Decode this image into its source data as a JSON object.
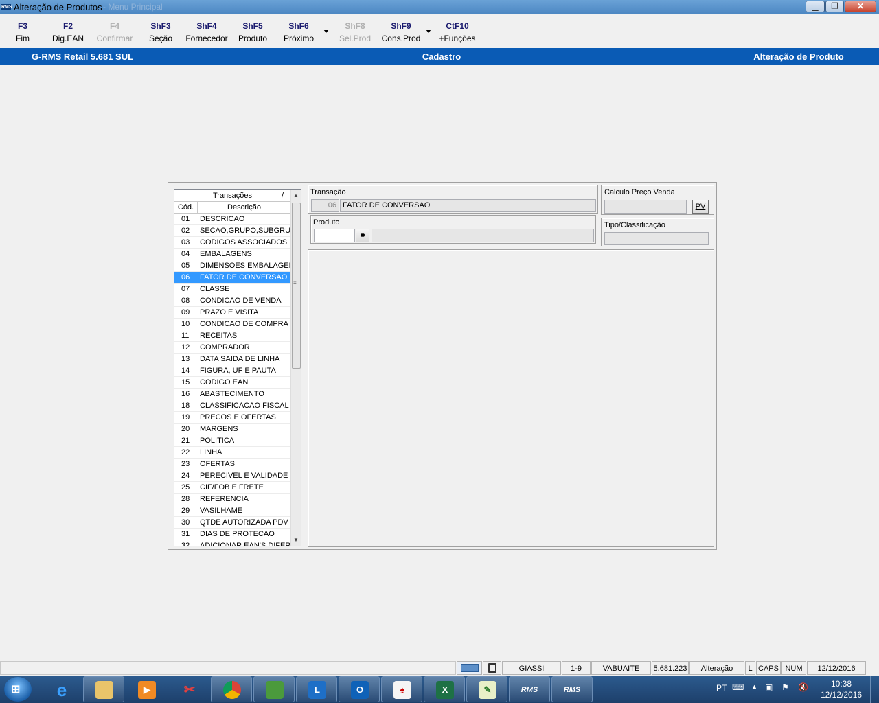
{
  "window": {
    "icon_label": "RMS",
    "title": "Alteração de Produtos",
    "title_faded": "-  Menu Principal",
    "buttons": [
      "minimize",
      "maximize",
      "close"
    ]
  },
  "toolbar": [
    {
      "key": "F3",
      "label": "Fim",
      "disabled": false
    },
    {
      "key": "F2",
      "label": "Dig.EAN",
      "disabled": false
    },
    {
      "key": "F4",
      "label": "Confirmar",
      "disabled": true
    },
    {
      "key": "ShF3",
      "label": "Seção",
      "disabled": false
    },
    {
      "key": "ShF4",
      "label": "Fornecedor",
      "disabled": false
    },
    {
      "key": "ShF5",
      "label": "Produto",
      "disabled": false
    },
    {
      "key": "ShF6",
      "label": "Próximo",
      "disabled": false
    },
    {
      "key": "ShF8",
      "label": "Sel.Prod",
      "disabled": true
    },
    {
      "key": "ShF9",
      "label": "Cons.Prod",
      "disabled": false
    },
    {
      "key": "CtF10",
      "label": "+Funções",
      "disabled": false
    }
  ],
  "header": {
    "system": "G-RMS Retail 5.681 SUL",
    "module": "Cadastro",
    "screen": "Alteração de Produto"
  },
  "transactions": {
    "title": "Transações",
    "sort_glyph": "/",
    "col_code": "Cód.",
    "col_desc": "Descrição",
    "selected_code": "06",
    "rows": [
      {
        "code": "01",
        "desc": "DESCRICAO"
      },
      {
        "code": "02",
        "desc": "SECAO,GRUPO,SUBGRUPO"
      },
      {
        "code": "03",
        "desc": "CODIGOS ASSOCIADOS"
      },
      {
        "code": "04",
        "desc": "EMBALAGENS"
      },
      {
        "code": "05",
        "desc": "DIMENSOES EMBALAGEM"
      },
      {
        "code": "06",
        "desc": "FATOR DE CONVERSAO"
      },
      {
        "code": "07",
        "desc": "CLASSE"
      },
      {
        "code": "08",
        "desc": "CONDICAO DE VENDA"
      },
      {
        "code": "09",
        "desc": "PRAZO E VISITA"
      },
      {
        "code": "10",
        "desc": "CONDICAO DE COMPRA"
      },
      {
        "code": "11",
        "desc": "RECEITAS"
      },
      {
        "code": "12",
        "desc": "COMPRADOR"
      },
      {
        "code": "13",
        "desc": "DATA SAIDA DE LINHA"
      },
      {
        "code": "14",
        "desc": "FIGURA, UF E PAUTA"
      },
      {
        "code": "15",
        "desc": "CODIGO EAN"
      },
      {
        "code": "16",
        "desc": "ABASTECIMENTO"
      },
      {
        "code": "18",
        "desc": "CLASSIFICACAO FISCAL"
      },
      {
        "code": "19",
        "desc": "PRECOS E OFERTAS"
      },
      {
        "code": "20",
        "desc": "MARGENS"
      },
      {
        "code": "21",
        "desc": "POLITICA"
      },
      {
        "code": "22",
        "desc": "LINHA"
      },
      {
        "code": "23",
        "desc": "OFERTAS"
      },
      {
        "code": "24",
        "desc": "PERECIVEL E VALIDADE"
      },
      {
        "code": "25",
        "desc": "CIF/FOB E FRETE"
      },
      {
        "code": "28",
        "desc": "REFERENCIA"
      },
      {
        "code": "29",
        "desc": "VASILHAME"
      },
      {
        "code": "30",
        "desc": "QTDE AUTORIZADA PDV"
      },
      {
        "code": "31",
        "desc": "DIAS DE PROTECAO"
      },
      {
        "code": "32",
        "desc": "ADICIONAR EAN'S DIFERE"
      }
    ]
  },
  "form": {
    "transacao_label": "Transação",
    "transacao_code": "06",
    "transacao_desc": "FATOR DE CONVERSAO",
    "produto_label": "Produto",
    "produto_code": "",
    "produto_desc": "",
    "calc_label": "Calculo Preço Venda",
    "calc_value": "",
    "pv_button": "PV",
    "tipo_label": "Tipo/Classificação",
    "tipo_value": ""
  },
  "statusbar": {
    "user": "GIASSI",
    "range": "1-9",
    "store": "VABUAITE",
    "version": "5.681.223",
    "mode": "Alteração",
    "l": "L",
    "caps": "CAPS",
    "num": "NUM",
    "date": "12/12/2016"
  },
  "taskbar": {
    "apps": [
      "internet-explorer",
      "file-explorer",
      "media-player",
      "snipping-tool",
      "chrome",
      "rms-db",
      "lync",
      "outlook",
      "solitaire",
      "excel",
      "notepad-plus-plus",
      "rms-1",
      "rms-2"
    ],
    "rms_label": "RMS",
    "language": "PT",
    "time": "10:38",
    "date": "12/12/2016"
  },
  "colors": {
    "header_blue": "#0a5bb5",
    "selection_blue": "#3399ff"
  }
}
